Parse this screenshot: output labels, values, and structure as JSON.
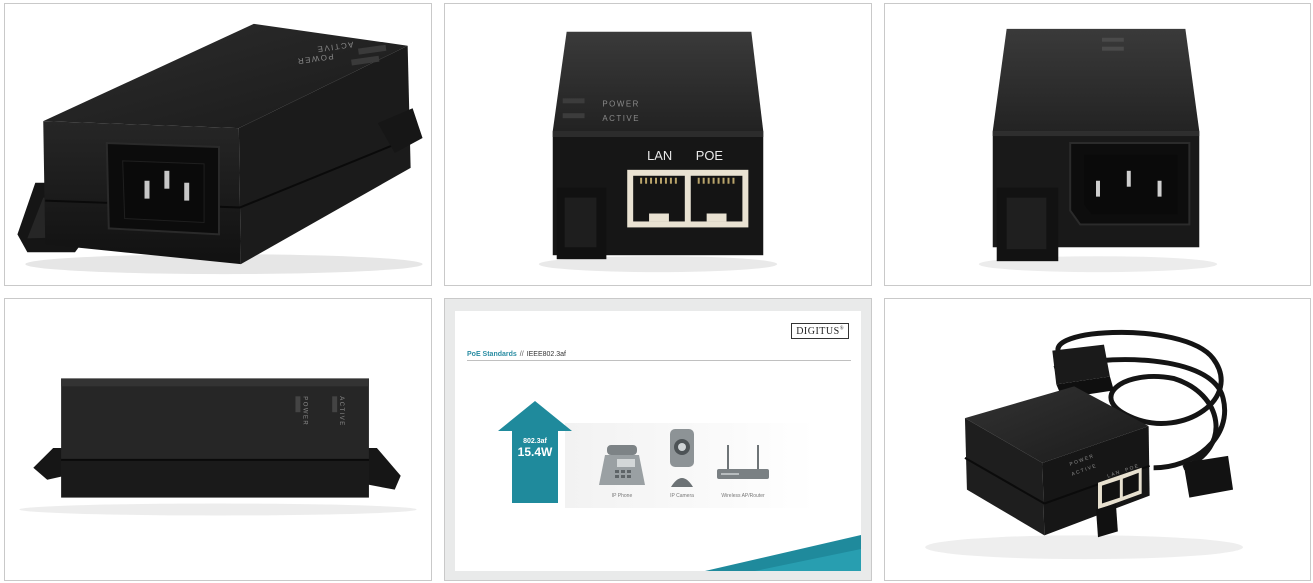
{
  "device": {
    "led_power": "POWER",
    "led_active": "ACTIVE",
    "port_lan": "LAN",
    "port_poe": "POE"
  },
  "slide": {
    "title": "PoE Standards",
    "separator": "//",
    "standard": "IEEE802.3af",
    "logo": "DIGITUS",
    "logo_mark": "®",
    "arrow_standard": "802.3af",
    "arrow_power": "15.4W",
    "devices": [
      "IP Phone",
      "IP Camera",
      "Wireless AP/Router"
    ],
    "accent_color": "#1f8a9c"
  }
}
